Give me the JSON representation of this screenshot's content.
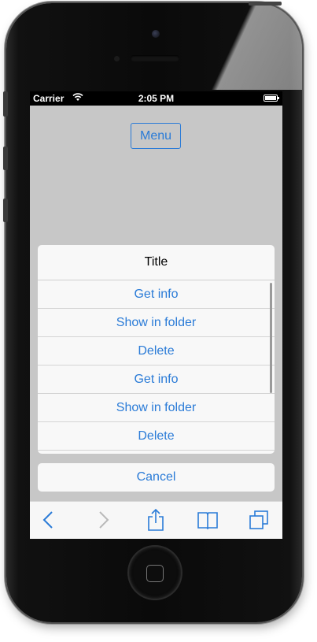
{
  "status_bar": {
    "carrier": "Carrier",
    "time": "2:05 PM"
  },
  "menu_button": {
    "label": "Menu"
  },
  "action_sheet": {
    "title": "Title",
    "items": [
      "Get info",
      "Show in folder",
      "Delete",
      "Get info",
      "Show in folder",
      "Delete"
    ],
    "cancel": "Cancel"
  },
  "toolbar": {
    "icons": [
      "back-icon",
      "forward-icon",
      "share-icon",
      "bookmarks-icon",
      "tabs-icon"
    ]
  },
  "colors": {
    "accent": "#2a7bd7",
    "background_dim": "#c7c7c7",
    "sheet": "#f8f8f8"
  }
}
